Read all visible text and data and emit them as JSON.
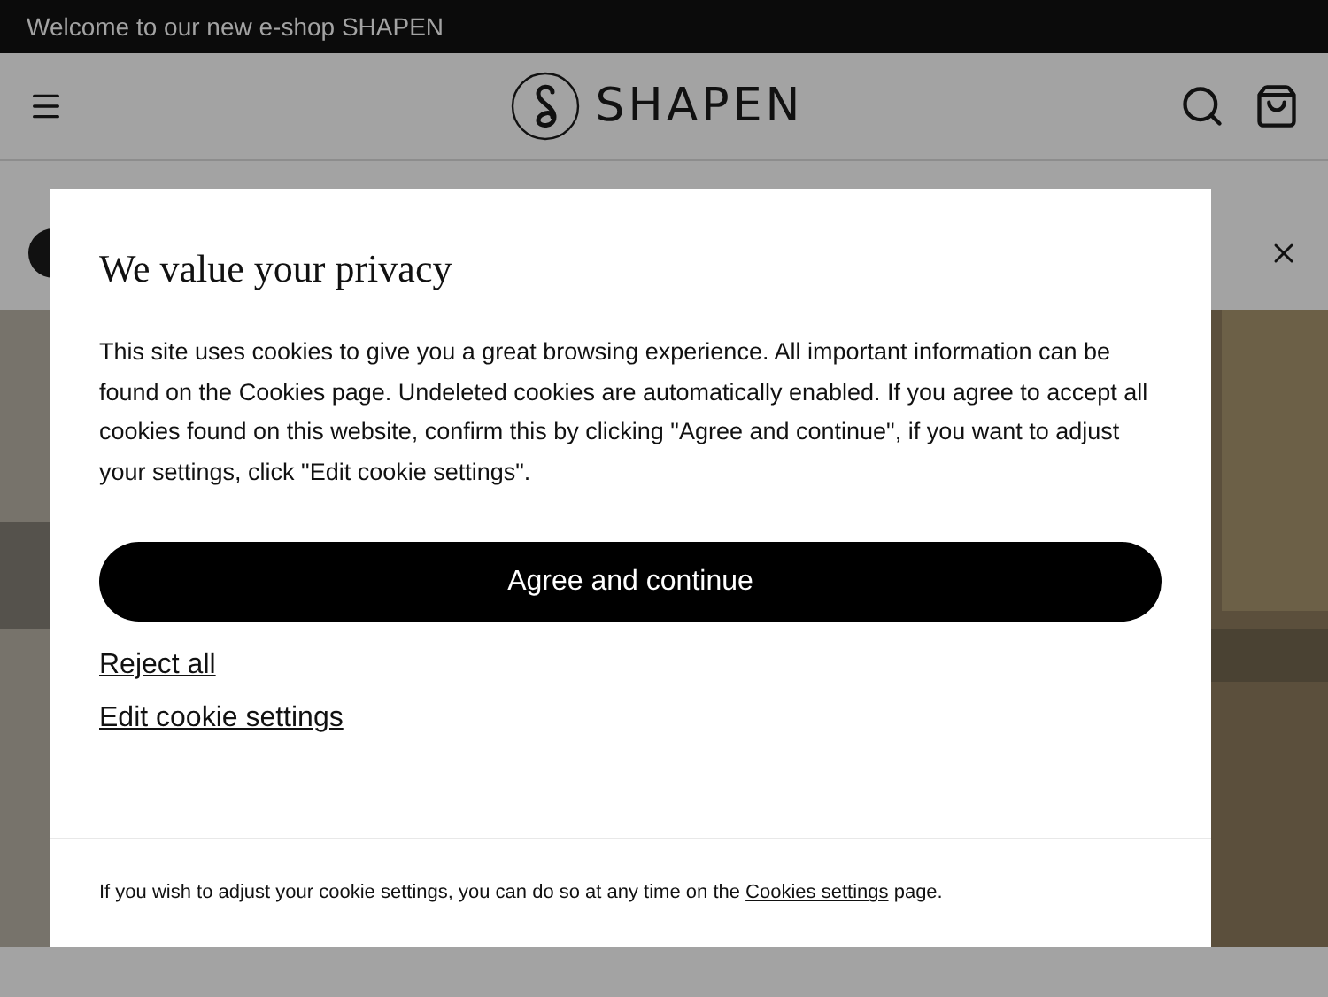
{
  "announcement": "Welcome to our new e-shop SHAPEN",
  "header": {
    "logo_text": "SHAPEN"
  },
  "modal": {
    "title": "We value your privacy",
    "body": "This site uses cookies to give you a great browsing experience. All important information can be found on the Cookies page. Undeleted cookies are automatically enabled. If you agree to accept all cookies found on this website, confirm this by clicking \"Agree and continue\", if you want to adjust your settings, click \"Edit cookie settings\".",
    "primary_button": "Agree and continue",
    "links": [
      "Reject all",
      "Edit cookie settings"
    ],
    "footer": {
      "text_before": "If you wish to adjust your cookie settings, you can do so at any time on the",
      "link": "Cookies settings",
      "text_after": "page."
    }
  }
}
